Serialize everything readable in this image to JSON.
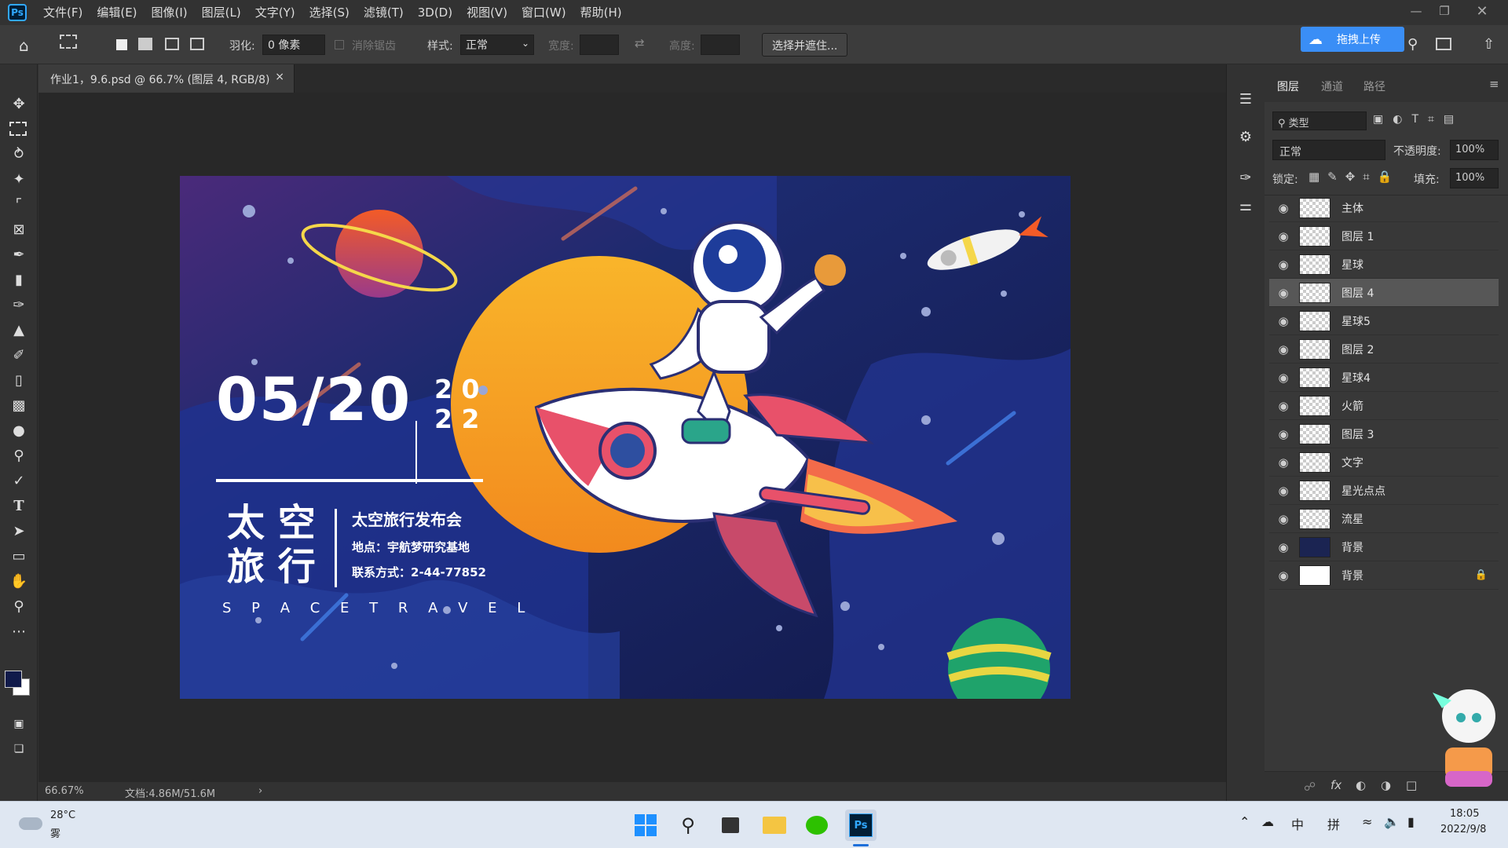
{
  "app": {
    "logo": "Ps"
  },
  "menu": [
    "文件(F)",
    "编辑(E)",
    "图像(I)",
    "图层(L)",
    "文字(Y)",
    "选择(S)",
    "滤镜(T)",
    "3D(D)",
    "视图(V)",
    "窗口(W)",
    "帮助(H)"
  ],
  "options": {
    "feather_label": "羽化:",
    "feather_value": "0 像素",
    "antialias_label": "消除锯齿",
    "style_label": "样式:",
    "style_value": "正常",
    "width_label": "宽度:",
    "height_label": "高度:",
    "select_mask_button": "选择并遮住...",
    "upload_button": "拖拽上传"
  },
  "document": {
    "tab_title": "作业1，9.6.psd @ 66.7% (图层 4, RGB/8)",
    "zoom": "66.67%",
    "doc_size": "文档:4.86M/51.6M"
  },
  "artwork": {
    "date": "05/20",
    "year_top": "2 0",
    "year_bottom": "2 2",
    "title_line1": "太 空",
    "title_line2": "旅 行",
    "event": "太空旅行发布会",
    "location": "地点：宇航梦研究基地",
    "contact": "联系方式：2-44-77852",
    "subtitle_en": "S P A C E   T R A V E L"
  },
  "layers_panel": {
    "tabs": [
      "图层",
      "通道",
      "路径"
    ],
    "filter_label": "类型",
    "blend_mode": "正常",
    "opacity_label": "不透明度:",
    "opacity_value": "100%",
    "lock_label": "锁定:",
    "fill_label": "填充:",
    "fill_value": "100%",
    "layers": [
      {
        "name": "主体"
      },
      {
        "name": "图层 1"
      },
      {
        "name": "星球"
      },
      {
        "name": "图层 4",
        "selected": true
      },
      {
        "name": "星球5"
      },
      {
        "name": "图层 2"
      },
      {
        "name": "星球4"
      },
      {
        "name": "火箭"
      },
      {
        "name": "图层 3"
      },
      {
        "name": "文字"
      },
      {
        "name": "星光点点"
      },
      {
        "name": "流星"
      },
      {
        "name": "背景"
      },
      {
        "name": "背景",
        "locked": true
      }
    ]
  },
  "taskbar": {
    "weather_temp": "28°C",
    "weather_desc": "雾",
    "ime_lang": "中",
    "ime_mode": "拼",
    "time": "18:05",
    "date": "2022/9/8"
  },
  "colors": {
    "accent": "#31a8ff",
    "upload": "#3a8ef6",
    "canvas_bg": "#1b2452",
    "sun": "#f7a928"
  }
}
